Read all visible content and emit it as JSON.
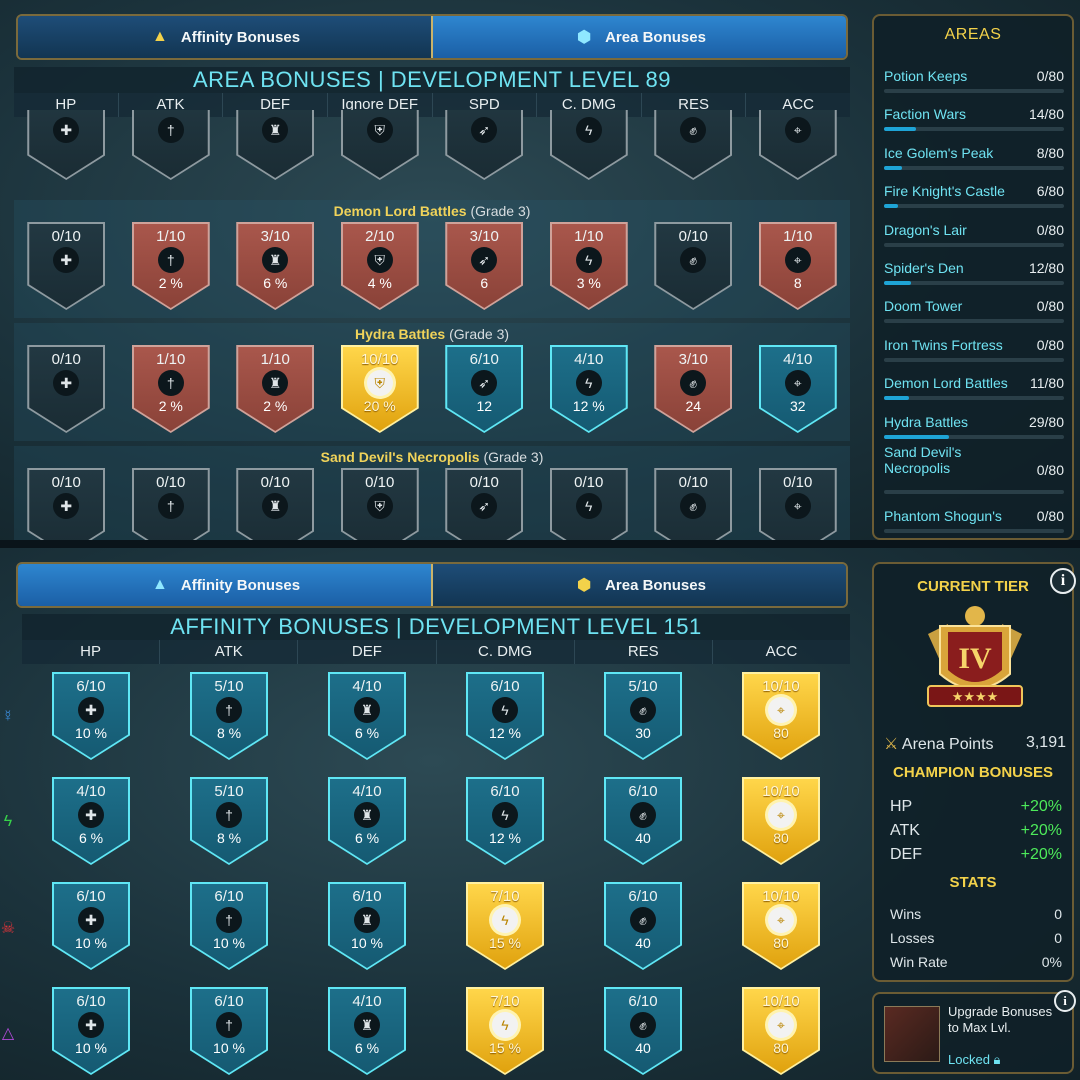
{
  "top_screen": {
    "tabs": [
      {
        "label": "Affinity Bonuses",
        "icon": "affinity-triangle-icon"
      },
      {
        "label": "Area Bonuses",
        "icon": "area-shield-icon"
      }
    ],
    "title": "AREA BONUSES | DEVELOPMENT LEVEL 89",
    "columns": [
      "HP",
      "ATK",
      "DEF",
      "Ignore DEF",
      "SPD",
      "C. DMG",
      "RES",
      "ACC"
    ],
    "sections": [
      {
        "name": "Demon Lord Battles",
        "grade": "(Grade 3)",
        "badges": [
          {
            "level": "0/10",
            "value": "",
            "color": "dark"
          },
          {
            "level": "1/10",
            "value": "2 %",
            "color": "red"
          },
          {
            "level": "3/10",
            "value": "6 %",
            "color": "red"
          },
          {
            "level": "2/10",
            "value": "4 %",
            "color": "red"
          },
          {
            "level": "3/10",
            "value": "6",
            "color": "red"
          },
          {
            "level": "1/10",
            "value": "3 %",
            "color": "red"
          },
          {
            "level": "0/10",
            "value": "",
            "color": "dark"
          },
          {
            "level": "1/10",
            "value": "8",
            "color": "red"
          }
        ]
      },
      {
        "name": "Hydra Battles",
        "grade": "(Grade 3)",
        "badges": [
          {
            "level": "0/10",
            "value": "",
            "color": "dark"
          },
          {
            "level": "1/10",
            "value": "2 %",
            "color": "red"
          },
          {
            "level": "1/10",
            "value": "2 %",
            "color": "red"
          },
          {
            "level": "10/10",
            "value": "20 %",
            "color": "gold"
          },
          {
            "level": "6/10",
            "value": "12",
            "color": "teal"
          },
          {
            "level": "4/10",
            "value": "12 %",
            "color": "teal"
          },
          {
            "level": "3/10",
            "value": "24",
            "color": "red"
          },
          {
            "level": "4/10",
            "value": "32",
            "color": "teal"
          }
        ]
      },
      {
        "name": "Sand Devil's Necropolis",
        "grade": "(Grade 3)",
        "badges": [
          {
            "level": "0/10",
            "value": "",
            "color": "dark"
          },
          {
            "level": "0/10",
            "value": "",
            "color": "dark"
          },
          {
            "level": "0/10",
            "value": "",
            "color": "dark"
          },
          {
            "level": "0/10",
            "value": "",
            "color": "dark"
          },
          {
            "level": "0/10",
            "value": "",
            "color": "dark"
          },
          {
            "level": "0/10",
            "value": "",
            "color": "dark"
          },
          {
            "level": "0/10",
            "value": "",
            "color": "dark"
          },
          {
            "level": "0/10",
            "value": "",
            "color": "dark"
          }
        ]
      }
    ],
    "stat_icons": [
      "hp-cross-icon",
      "atk-sword-icon",
      "def-tower-icon",
      "ignore-def-armor-icon",
      "spd-bird-icon",
      "cdmg-bolt-icon",
      "res-fist-icon",
      "acc-crosshair-icon"
    ],
    "areas_panel": {
      "title": "AREAS",
      "items": [
        {
          "name": "Potion Keeps",
          "count": "0/80",
          "progress": 0
        },
        {
          "name": "Faction Wars",
          "count": "14/80",
          "progress": 0.175
        },
        {
          "name": "Ice Golem's Peak",
          "count": "8/80",
          "progress": 0.1
        },
        {
          "name": "Fire Knight's Castle",
          "count": "6/80",
          "progress": 0.075
        },
        {
          "name": "Dragon's Lair",
          "count": "0/80",
          "progress": 0
        },
        {
          "name": "Spider's Den",
          "count": "12/80",
          "progress": 0.15
        },
        {
          "name": "Doom Tower",
          "count": "0/80",
          "progress": 0
        },
        {
          "name": "Iron Twins Fortress",
          "count": "0/80",
          "progress": 0
        },
        {
          "name": "Demon Lord Battles",
          "count": "11/80",
          "progress": 0.1375
        },
        {
          "name": "Hydra Battles",
          "count": "29/80",
          "progress": 0.3625
        },
        {
          "name": "Sand Devil's Necropolis",
          "count": "0/80",
          "progress": 0
        },
        {
          "name": "Phantom Shogun's",
          "count": "0/80",
          "progress": 0
        }
      ]
    }
  },
  "bottom_screen": {
    "tabs": [
      {
        "label": "Affinity Bonuses",
        "icon": "affinity-triangle-icon"
      },
      {
        "label": "Area Bonuses",
        "icon": "area-shield-icon"
      }
    ],
    "title": "AFFINITY BONUSES | DEVELOPMENT LEVEL 151",
    "columns": [
      "HP",
      "ATK",
      "DEF",
      "C. DMG",
      "RES",
      "ACC"
    ],
    "stat_icons": [
      "hp-cross-icon",
      "atk-sword-icon",
      "def-tower-icon",
      "cdmg-bolt-icon",
      "res-fist-icon",
      "acc-crosshair-icon"
    ],
    "rows": [
      {
        "affinity_icon": "magic-affinity-icon",
        "affinity_color": "#3b8fe0",
        "badges": [
          {
            "level": "6/10",
            "value": "10 %",
            "color": "teal"
          },
          {
            "level": "5/10",
            "value": "8 %",
            "color": "teal"
          },
          {
            "level": "4/10",
            "value": "6 %",
            "color": "teal"
          },
          {
            "level": "6/10",
            "value": "12 %",
            "color": "teal"
          },
          {
            "level": "5/10",
            "value": "30",
            "color": "teal"
          },
          {
            "level": "10/10",
            "value": "80",
            "color": "gold"
          }
        ]
      },
      {
        "affinity_icon": "spirit-affinity-icon",
        "affinity_color": "#37d24a",
        "badges": [
          {
            "level": "4/10",
            "value": "6 %",
            "color": "teal"
          },
          {
            "level": "5/10",
            "value": "8 %",
            "color": "teal"
          },
          {
            "level": "4/10",
            "value": "6 %",
            "color": "teal"
          },
          {
            "level": "6/10",
            "value": "12 %",
            "color": "teal"
          },
          {
            "level": "6/10",
            "value": "40",
            "color": "teal"
          },
          {
            "level": "10/10",
            "value": "80",
            "color": "gold"
          }
        ]
      },
      {
        "affinity_icon": "force-affinity-icon",
        "affinity_color": "#e0343a",
        "badges": [
          {
            "level": "6/10",
            "value": "10 %",
            "color": "teal"
          },
          {
            "level": "6/10",
            "value": "10 %",
            "color": "teal"
          },
          {
            "level": "6/10",
            "value": "10 %",
            "color": "teal"
          },
          {
            "level": "7/10",
            "value": "15 %",
            "color": "gold"
          },
          {
            "level": "6/10",
            "value": "40",
            "color": "teal"
          },
          {
            "level": "10/10",
            "value": "80",
            "color": "gold"
          }
        ]
      },
      {
        "affinity_icon": "void-affinity-icon",
        "affinity_color": "#b04ad8",
        "badges": [
          {
            "level": "6/10",
            "value": "10 %",
            "color": "teal"
          },
          {
            "level": "6/10",
            "value": "10 %",
            "color": "teal"
          },
          {
            "level": "4/10",
            "value": "6 %",
            "color": "teal"
          },
          {
            "level": "7/10",
            "value": "15 %",
            "color": "gold"
          },
          {
            "level": "6/10",
            "value": "40",
            "color": "teal"
          },
          {
            "level": "10/10",
            "value": "80",
            "color": "gold"
          }
        ]
      }
    ],
    "tier_panel": {
      "title": "CURRENT TIER",
      "tier_numeral": "IV",
      "arena_points_label": "Arena Points",
      "arena_points": "3,191",
      "champion_bonuses_title": "CHAMPION BONUSES",
      "champion_bonuses": [
        {
          "stat": "HP",
          "value": "+20%"
        },
        {
          "stat": "ATK",
          "value": "+20%"
        },
        {
          "stat": "DEF",
          "value": "+20%"
        }
      ],
      "stats_title": "STATS",
      "stats": [
        {
          "label": "Wins",
          "value": "0"
        },
        {
          "label": "Losses",
          "value": "0"
        },
        {
          "label": "Win Rate",
          "value": "0%"
        }
      ]
    },
    "upgrade_panel": {
      "text": "Upgrade Bonuses to Max Lvl.",
      "status": "Locked"
    }
  },
  "colors": {
    "accent_cyan": "#6fe3f2",
    "gold": "#f3d24a",
    "green": "#4dea5a",
    "tab_active": "#2e86d0"
  }
}
